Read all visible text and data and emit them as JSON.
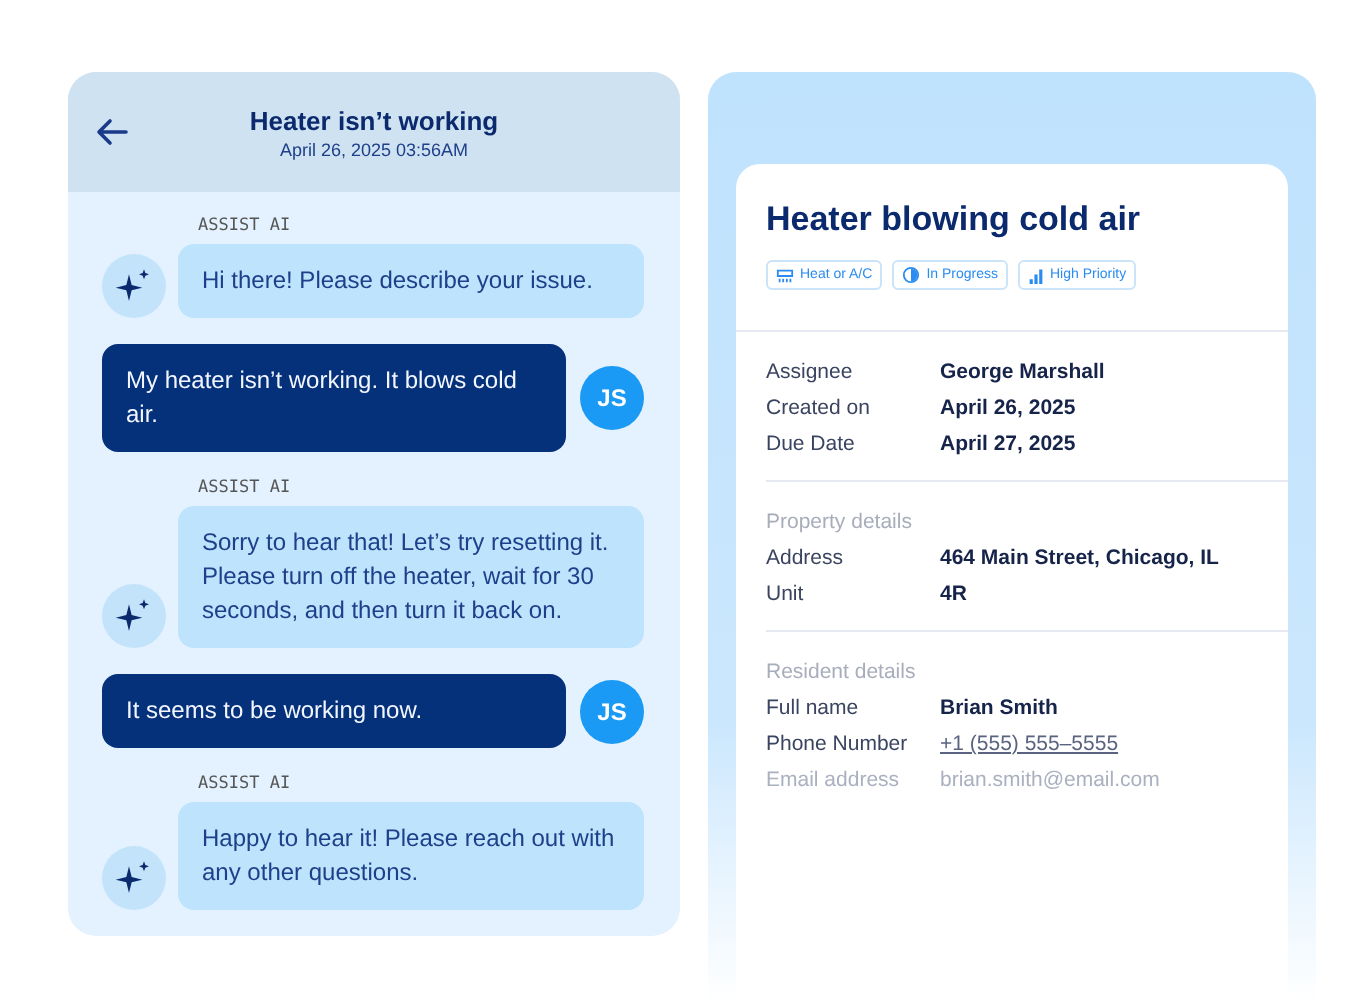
{
  "chat": {
    "title": "Heater isn’t working",
    "timestamp": "April 26, 2025 03:56AM",
    "messages": [
      {
        "kind": "ai",
        "sender": "ASSIST AI",
        "text": "Hi there! Please describe your issue."
      },
      {
        "kind": "user",
        "initials": "JS",
        "text": "My heater isn’t working. It blows cold air."
      },
      {
        "kind": "ai",
        "sender": "ASSIST AI",
        "text": "Sorry to hear that! Let’s try resetting it. Please turn off the heater, wait for 30 seconds, and then turn it back on."
      },
      {
        "kind": "user",
        "initials": "JS",
        "text": "It seems to be working now."
      },
      {
        "kind": "ai",
        "sender": "ASSIST AI",
        "text": "Happy to hear it! Please reach out with any other questions."
      }
    ]
  },
  "ticket": {
    "title": "Heater blowing cold air",
    "tags": [
      {
        "kind": "category",
        "label": "Heat or A/C"
      },
      {
        "kind": "status",
        "label": "In Progress"
      },
      {
        "kind": "priority",
        "label": "High Priority"
      }
    ],
    "sections": [
      {
        "rows": [
          {
            "label": "Assignee",
            "value": "George Marshall"
          },
          {
            "label": "Created on",
            "value": "April 26, 2025"
          },
          {
            "label": "Due Date",
            "value": "April 27, 2025"
          }
        ]
      },
      {
        "heading": "Property details",
        "rows": [
          {
            "label": "Address",
            "value": "464 Main Street, Chicago, IL"
          },
          {
            "label": "Unit",
            "value": "4R"
          }
        ]
      },
      {
        "heading": "Resident details",
        "rows": [
          {
            "label": "Full name",
            "value": "Brian Smith"
          },
          {
            "label": "Phone Number",
            "value": "+1 (555) 555–5555",
            "kind": "link"
          },
          {
            "label": "Email address",
            "value": "brian.smith@email.com",
            "kind": "faded"
          }
        ]
      }
    ]
  }
}
